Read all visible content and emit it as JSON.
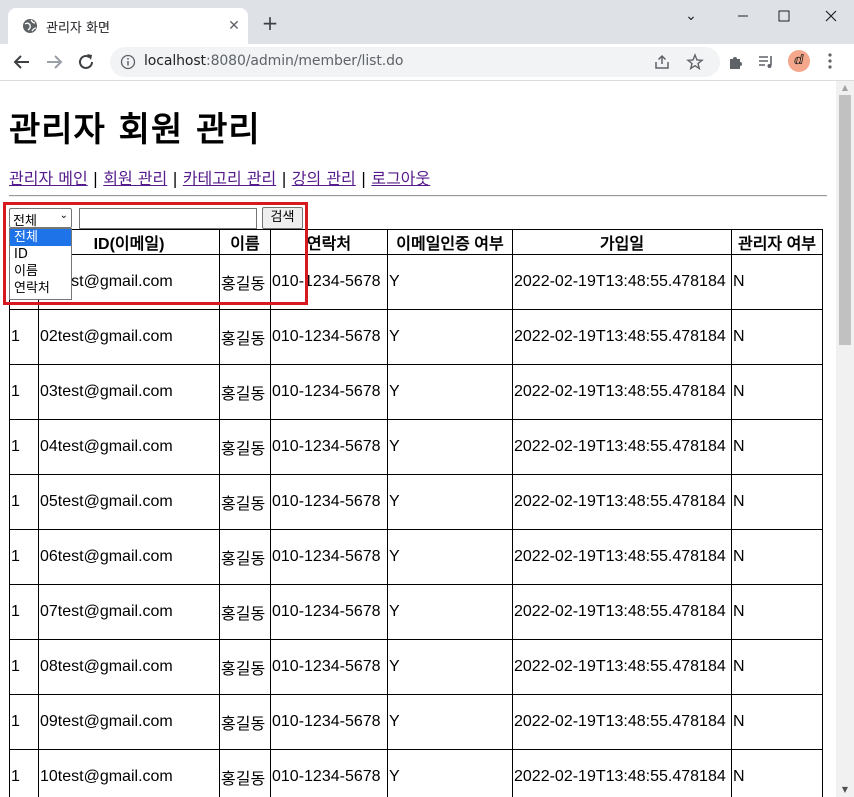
{
  "browser": {
    "tab_title": "관리자 화면",
    "url_host": "localhost",
    "url_rest": ":8080/admin/member/list.do",
    "minimize_glyph": "⌄",
    "new_tab_glyph": "+",
    "close_tab_glyph": "✕"
  },
  "page": {
    "title": "관리자 회원 관리",
    "nav": [
      {
        "label": "관리자 메인"
      },
      {
        "label": "회원 관리"
      },
      {
        "label": "카테고리 관리"
      },
      {
        "label": "강의 관리"
      },
      {
        "label": "로그아웃"
      }
    ],
    "nav_separator": "|"
  },
  "search": {
    "select_value": "전체",
    "options": [
      "전체",
      "ID",
      "이름",
      "연락처"
    ],
    "input_value": "",
    "button_label": "검색"
  },
  "table": {
    "headers": [
      "",
      "ID(이메일)",
      "이름",
      "연락처",
      "이메일인증 여부",
      "가입일",
      "관리자 여부"
    ],
    "rows": [
      [
        "",
        "01test@gmail.com",
        "홍길동",
        "010-1234-5678",
        "Y",
        "2022-02-19T13:48:55.478184",
        "N"
      ],
      [
        "1",
        "02test@gmail.com",
        "홍길동",
        "010-1234-5678",
        "Y",
        "2022-02-19T13:48:55.478184",
        "N"
      ],
      [
        "1",
        "03test@gmail.com",
        "홍길동",
        "010-1234-5678",
        "Y",
        "2022-02-19T13:48:55.478184",
        "N"
      ],
      [
        "1",
        "04test@gmail.com",
        "홍길동",
        "010-1234-5678",
        "Y",
        "2022-02-19T13:48:55.478184",
        "N"
      ],
      [
        "1",
        "05test@gmail.com",
        "홍길동",
        "010-1234-5678",
        "Y",
        "2022-02-19T13:48:55.478184",
        "N"
      ],
      [
        "1",
        "06test@gmail.com",
        "홍길동",
        "010-1234-5678",
        "Y",
        "2022-02-19T13:48:55.478184",
        "N"
      ],
      [
        "1",
        "07test@gmail.com",
        "홍길동",
        "010-1234-5678",
        "Y",
        "2022-02-19T13:48:55.478184",
        "N"
      ],
      [
        "1",
        "08test@gmail.com",
        "홍길동",
        "010-1234-5678",
        "Y",
        "2022-02-19T13:48:55.478184",
        "N"
      ],
      [
        "1",
        "09test@gmail.com",
        "홍길동",
        "010-1234-5678",
        "Y",
        "2022-02-19T13:48:55.478184",
        "N"
      ],
      [
        "1",
        "10test@gmail.com",
        "홍길동",
        "010-1234-5678",
        "Y",
        "2022-02-19T13:48:55.478184",
        "N"
      ]
    ]
  },
  "colors": {
    "highlight": "#d71920",
    "link_visited": "#551a8b",
    "option_selected": "#1e73e8"
  }
}
